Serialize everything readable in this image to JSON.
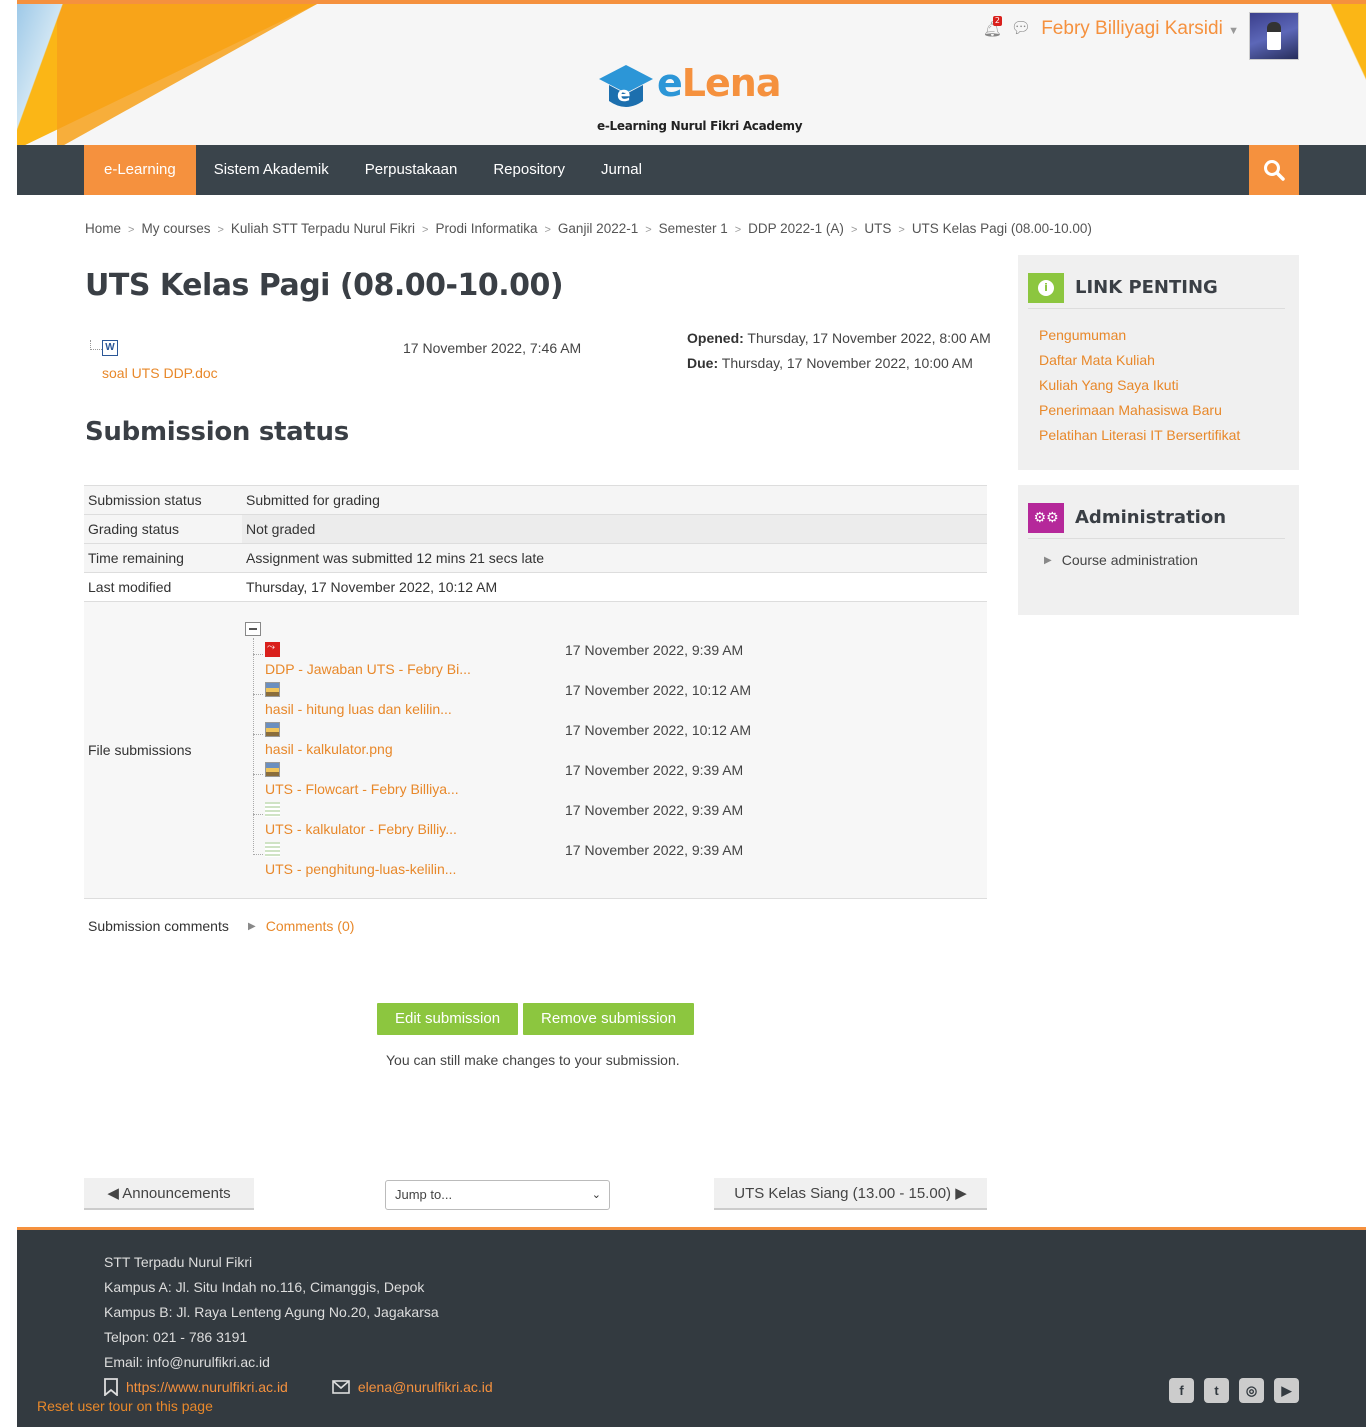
{
  "header": {
    "logo_e": "e",
    "logo_lena": "Lena",
    "logo_subtitle": "e-Learning Nurul Fikri Academy",
    "notification_count": "2",
    "user_name": "Febry Billiyagi Karsidi"
  },
  "nav": {
    "items": [
      "e-Learning",
      "Sistem Akademik",
      "Perpustakaan",
      "Repository",
      "Jurnal"
    ],
    "active": "e-Learning"
  },
  "breadcrumb": [
    "Home",
    "My courses",
    "Kuliah STT Terpadu Nurul Fikri",
    "Prodi Informatika",
    "Ganjil 2022-1",
    "Semester 1",
    "DDP 2022-1 (A)",
    "UTS",
    "UTS Kelas Pagi (08.00-10.00)"
  ],
  "main": {
    "title": "UTS Kelas Pagi (08.00-10.00)",
    "intro_file": {
      "name": "soal UTS DDP.doc",
      "date": "17 November 2022, 7:46 AM"
    },
    "opened_label": "Opened:",
    "opened_value": " Thursday, 17 November 2022, 8:00 AM",
    "due_label": "Due:",
    "due_value": " Thursday, 17 November 2022, 10:00 AM",
    "submission_heading": "Submission status",
    "rows": [
      {
        "label": "Submission status",
        "value": "Submitted for grading"
      },
      {
        "label": "Grading status",
        "value": "Not graded"
      },
      {
        "label": "Time remaining",
        "value": "Assignment was submitted 12 mins 21 secs late"
      },
      {
        "label": "Last modified",
        "value": "Thursday, 17 November 2022, 10:12 AM"
      },
      {
        "label": "File submissions",
        "value": ""
      }
    ],
    "files": [
      {
        "name": "DDP - Jawaban UTS - Febry Bi...",
        "date": "17 November 2022, 9:39 AM",
        "icon": "pdf-icon"
      },
      {
        "name": "hasil - hitung luas dan kelilin...",
        "date": "17 November 2022, 10:12 AM",
        "icon": "image-icon"
      },
      {
        "name": "hasil - kalkulator.png",
        "date": "17 November 2022, 10:12 AM",
        "icon": "image-icon"
      },
      {
        "name": "UTS - Flowcart - Febry Billiya...",
        "date": "17 November 2022, 9:39 AM",
        "icon": "image-icon"
      },
      {
        "name": "UTS - kalkulator - Febry Billiy...",
        "date": "17 November 2022, 9:39 AM",
        "icon": "text-file-icon"
      },
      {
        "name": "UTS - penghitung-luas-kelilin...",
        "date": "17 November 2022, 9:39 AM",
        "icon": "text-file-icon"
      }
    ],
    "comments_label": "Submission comments",
    "comments_link": "Comments (0)",
    "edit_button": "Edit submission",
    "remove_button": "Remove submission",
    "note": "You can still make changes to your submission.",
    "prev_link": "◀ Announcements",
    "jump_placeholder": "Jump to...",
    "next_link": "UTS Kelas Siang (13.00 - 15.00) ▶"
  },
  "sidebar": {
    "link_block_title": "LINK PENTING",
    "links": [
      "Pengumuman",
      "Daftar Mata Kuliah",
      "Kuliah Yang Saya Ikuti",
      "Penerimaan Mahasiswa Baru",
      "Pelatihan Literasi IT Bersertifikat"
    ],
    "admin_title": "Administration",
    "admin_item": "Course administration"
  },
  "footer": {
    "lines": [
      "STT Terpadu Nurul Fikri",
      "Kampus A: Jl. Situ Indah no.116, Cimanggis, Depok",
      "Kampus B: Jl. Raya Lenteng Agung No.20, Jagakarsa",
      "Telpon: 021 - 786 3191",
      "Email: info@nurulfikri.ac.id"
    ],
    "website": "https://www.nurulfikri.ac.id",
    "email": "elena@nurulfikri.ac.id",
    "reset_tour": "Reset user tour on this page"
  },
  "colors": {
    "accent": "#f5913e",
    "nav_bg": "#3a444b",
    "button_green": "#8cc63f",
    "footer_bg": "#333a40"
  }
}
